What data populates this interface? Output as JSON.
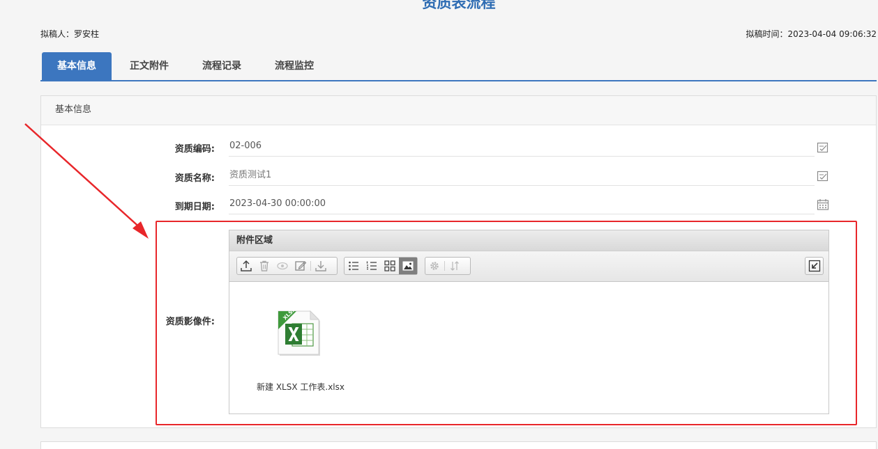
{
  "page": {
    "title": "资质表流程",
    "drafter": "拟稿人：罗安柱",
    "draft_time": "拟稿时间：2023-04-04 09:06:32"
  },
  "tabs": [
    {
      "label": "基本信息",
      "active": true
    },
    {
      "label": "正文附件",
      "active": false
    },
    {
      "label": "流程记录",
      "active": false
    },
    {
      "label": "流程监控",
      "active": false
    }
  ],
  "panel": {
    "header": "基本信息"
  },
  "fields": [
    {
      "label": "资质编码:",
      "value": "02-006",
      "icon": "edit-icon"
    },
    {
      "label": "资质名称:",
      "value": "资质测试1",
      "icon": "edit-icon"
    },
    {
      "label": "到期日期:",
      "value": "2023-04-30 00:00:00",
      "icon": "calendar-icon"
    }
  ],
  "attachment": {
    "label": "资质影像件:",
    "area_title": "附件区域",
    "toolbar_icons": [
      "upload-icon",
      "delete-icon",
      "preview-icon",
      "edit-icon",
      "download-icon",
      "list-icon",
      "numbered-list-icon",
      "grid-icon",
      "image-view-icon",
      "settings-icon",
      "sort-icon",
      "collapse-icon"
    ],
    "files": [
      {
        "name": "新建 XLSX 工作表.xlsx",
        "type": "xlsx"
      }
    ]
  },
  "colors": {
    "primary": "#3c76bf",
    "highlight": "#e8262a",
    "title": "#2e6cb3"
  }
}
